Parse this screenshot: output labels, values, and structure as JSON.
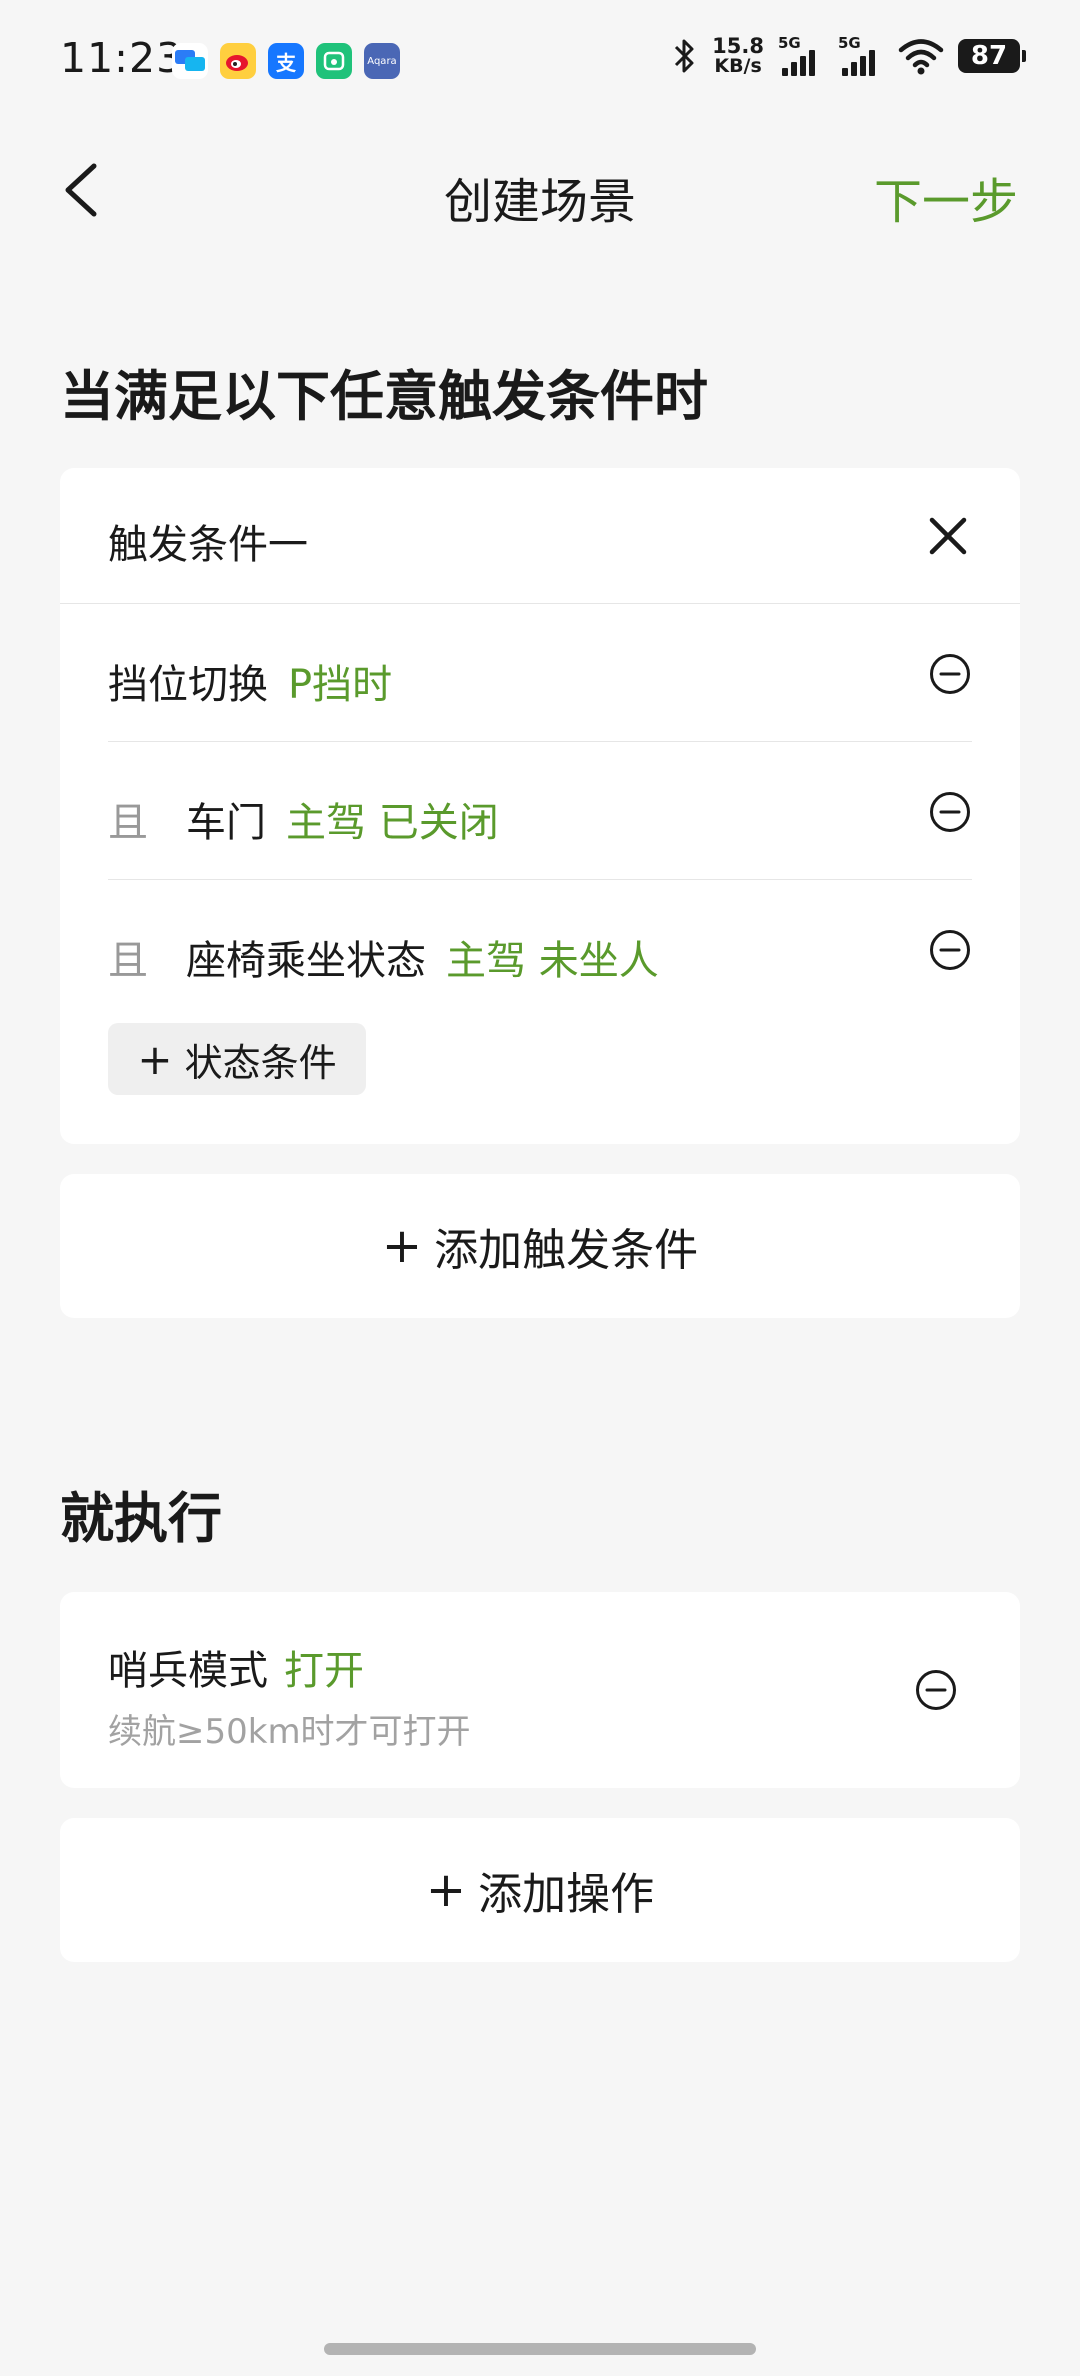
{
  "status_bar": {
    "time": "11:23",
    "net_speed_value": "15.8",
    "net_speed_unit": "KB/s",
    "signal1_label": "5G",
    "signal2_label": "5G",
    "battery_level": "87",
    "app_icons": [
      "message-app-icon",
      "weibo-icon",
      "alipay-icon",
      "mijia-icon",
      "aqara-icon"
    ]
  },
  "header": {
    "title": "创建场景",
    "next_label": "下一步"
  },
  "trigger_section": {
    "title": "当满足以下任意触发条件时",
    "card": {
      "title": "触发条件一",
      "conditions": [
        {
          "prefix": "",
          "name": "挡位切换",
          "value": "P挡时"
        },
        {
          "prefix": "且",
          "name": "车门",
          "value": "主驾 已关闭"
        },
        {
          "prefix": "且",
          "name": "座椅乘坐状态",
          "value": "主驾 未坐人"
        }
      ],
      "add_state_label": "状态条件"
    },
    "add_trigger_label": "添加触发条件"
  },
  "action_section": {
    "title": "就执行",
    "action": {
      "name": "哨兵模式",
      "value": "打开",
      "note": "续航≥50km时才可打开"
    },
    "add_action_label": "添加操作"
  },
  "colors": {
    "accent": "#5a9a2c",
    "background": "#f6f6f6",
    "card": "#ffffff",
    "muted_text": "#a2a2a2"
  }
}
